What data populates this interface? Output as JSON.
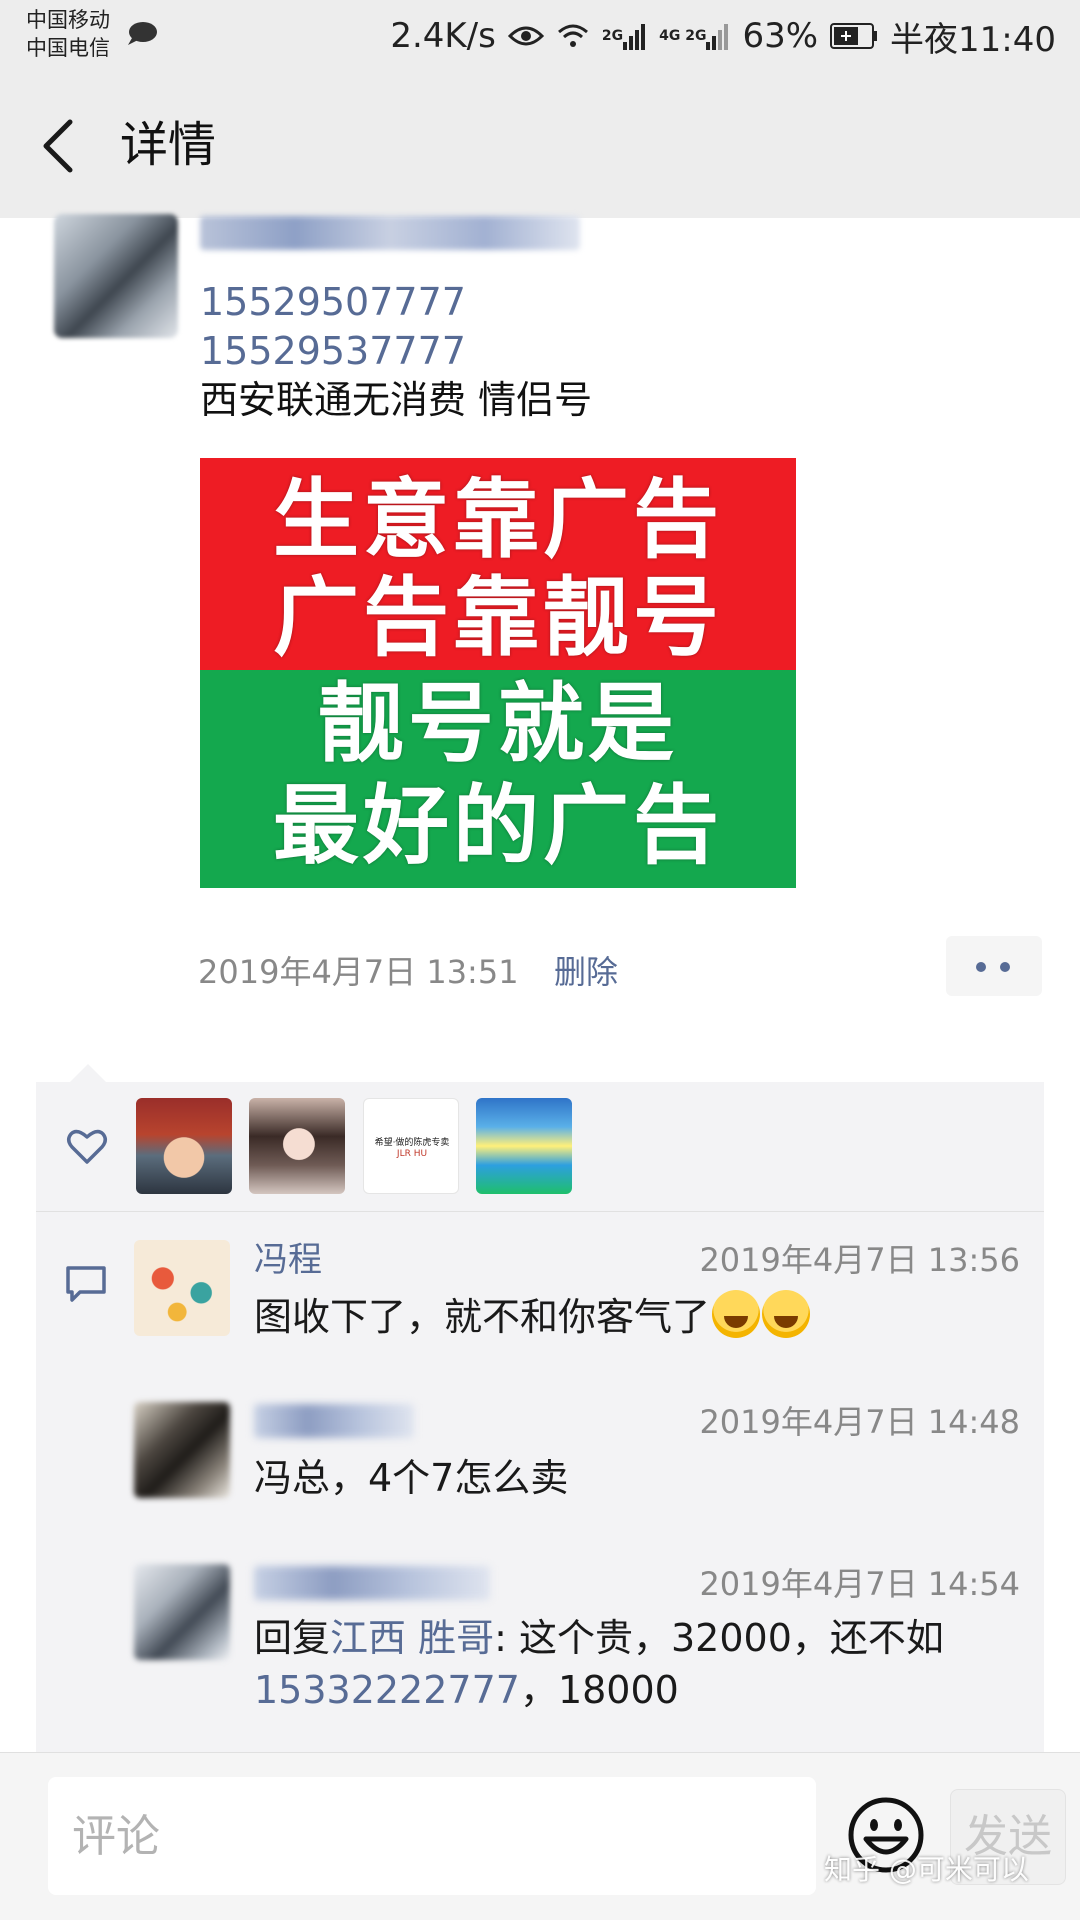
{
  "status_bar": {
    "carrier_1": "中国移动",
    "carrier_2": "中国电信",
    "net_speed": "2.4K/s",
    "signal_1_tag": "2G",
    "signal_2_tag": "4G 2G",
    "battery": "63%",
    "time": "半夜11:40"
  },
  "header": {
    "title": "详情"
  },
  "post": {
    "phone_1": "15529507777",
    "phone_2": "15529537777",
    "text": "西安联通无消费  情侣号",
    "poster_lines": [
      "生意靠广告",
      "广告靠靓号",
      "靓号就是",
      "最好的广告"
    ],
    "timestamp": "2019年4月7日 13:51",
    "delete_label": "删除"
  },
  "likes": {
    "liker_3_text_1": "希望·做的陈虎专卖",
    "liker_3_text_2": "JLR HU"
  },
  "comments": [
    {
      "name": "冯程",
      "time": "2019年4月7日 13:56",
      "text": "图收下了，就不和你客气了"
    },
    {
      "time": "2019年4月7日 14:48",
      "text": "冯总，4个7怎么卖"
    },
    {
      "time": "2019年4月7日 14:54",
      "reply_prefix": "回复",
      "reply_to": "江西 胜哥",
      "text_a": ": 这个贵，32000，还不如",
      "phone": "15332222777",
      "text_b": "，18000"
    }
  ],
  "input_bar": {
    "placeholder": "评论",
    "send_label": "发送"
  },
  "watermark": "知乎 @可米可以",
  "colors": {
    "link": "#576b95",
    "poster_red": "#ee1c24",
    "poster_green": "#14a84e",
    "header_bg": "#ededed"
  },
  "icons": [
    "chat-bubble-icon",
    "eye-icon",
    "wifi-icon",
    "signal-icon",
    "battery-icon",
    "back-arrow-icon",
    "more-icon",
    "heart-icon",
    "comment-icon",
    "emoji-icon"
  ]
}
